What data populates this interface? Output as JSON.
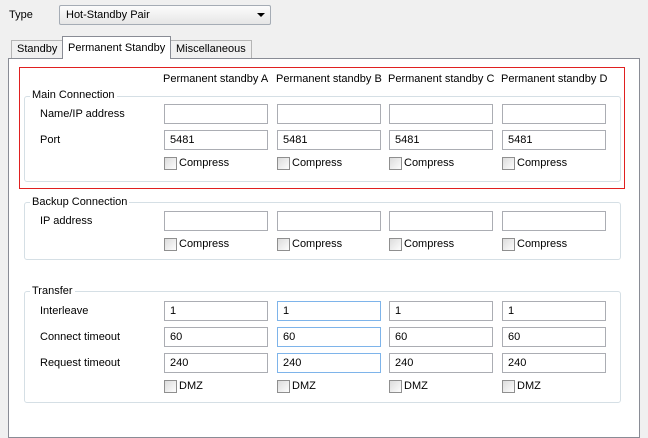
{
  "type_field": {
    "label": "Type",
    "value": "Hot-Standby Pair"
  },
  "tabs": [
    {
      "label": "Standby"
    },
    {
      "label": "Permanent Standby"
    },
    {
      "label": "Miscellaneous"
    }
  ],
  "columns": [
    "Permanent standby A",
    "Permanent standby B",
    "Permanent standby C",
    "Permanent standby D"
  ],
  "main_connection": {
    "title": "Main Connection",
    "name_label": "Name/IP address",
    "name_values": [
      "",
      "",
      "",
      ""
    ],
    "port_label": "Port",
    "port_values": [
      "5481",
      "5481",
      "5481",
      "5481"
    ],
    "compress_label": "Compress"
  },
  "backup_connection": {
    "title": "Backup Connection",
    "ip_label": "IP address",
    "ip_values": [
      "",
      "",
      "",
      ""
    ],
    "compress_label": "Compress"
  },
  "transfer": {
    "title": "Transfer",
    "interleave_label": "Interleave",
    "interleave_values": [
      "1",
      "1",
      "1",
      "1"
    ],
    "connect_timeout_label": "Connect timeout",
    "connect_timeout_values": [
      "60",
      "60",
      "60",
      "60"
    ],
    "request_timeout_label": "Request timeout",
    "request_timeout_values": [
      "240",
      "240",
      "240",
      "240"
    ],
    "dmz_label": "DMZ"
  },
  "colors": {
    "highlight": "#e02020",
    "focus_border": "#7eb4ea"
  }
}
